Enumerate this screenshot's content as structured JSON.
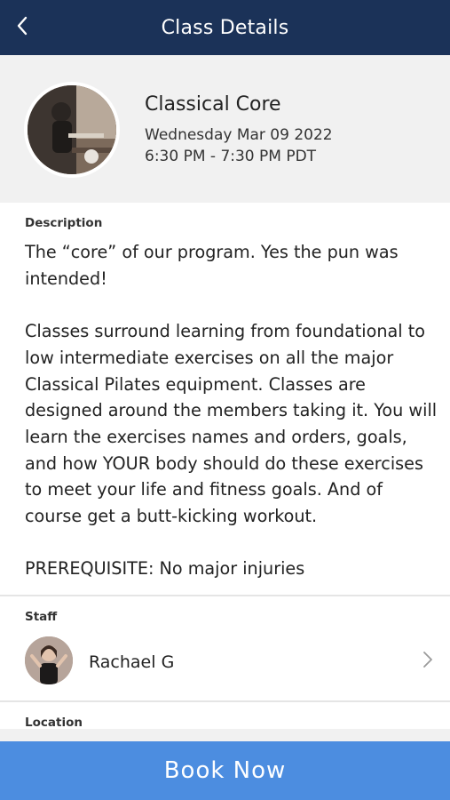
{
  "header": {
    "title": "Class Details",
    "back_icon": "chevron-left-icon"
  },
  "class_info": {
    "name": "Classical Core",
    "date": "Wednesday Mar 09 2022",
    "time": "6:30 PM - 7:30 PM PDT"
  },
  "description": {
    "label": "Description",
    "text": "The “core” of our program. Yes the pun was intended!\n\nClasses surround learning from foundational to low intermediate exercises on all the major Classical Pilates equipment.  Classes are designed around the members taking it.  You will learn the exercises names and orders, goals, and how YOUR body should do these exercises to meet your life and fitness goals. And of course get a butt-kicking workout.\n\nPREREQUISITE: No major injuries"
  },
  "staff": {
    "label": "Staff",
    "name": "Rachael G",
    "chevron_icon": "chevron-right-icon"
  },
  "location": {
    "label": "Location"
  },
  "actions": {
    "book_label": "Book Now"
  },
  "colors": {
    "header_bg": "#1b3258",
    "summary_bg": "#f1f1f1",
    "button_bg": "#4c8de0"
  }
}
